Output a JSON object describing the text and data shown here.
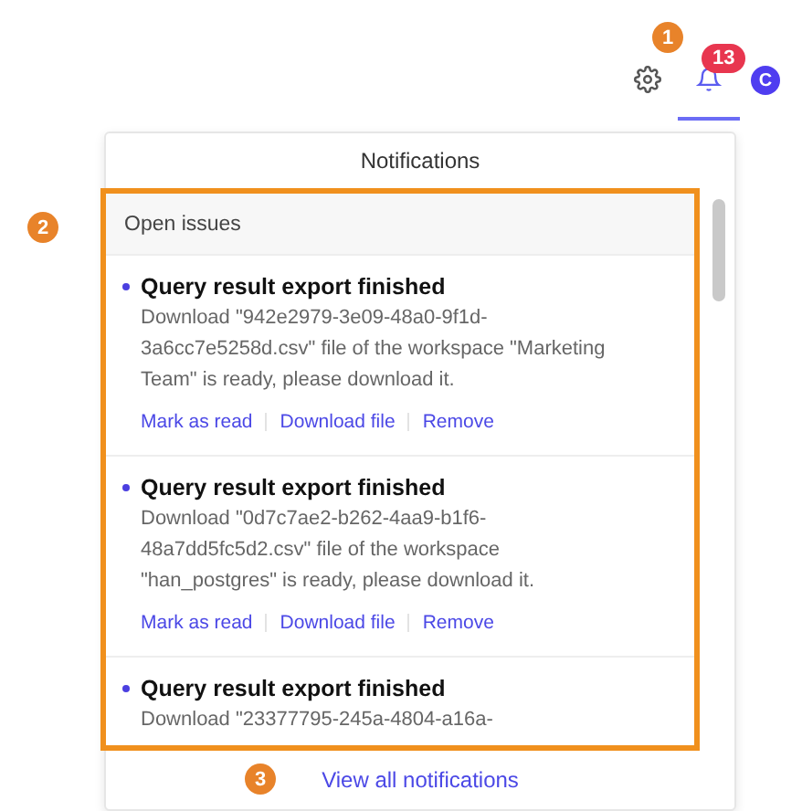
{
  "topbar": {
    "notification_count": "13",
    "avatar": "C",
    "bell_selected": true
  },
  "panel": {
    "title": "Notifications",
    "section": "Open issues",
    "items": [
      {
        "title": "Query result export finished",
        "unread": true,
        "description": "Download \"942e2979-3e09-48a0-9f1d-3a6cc7e5258d.csv\" file of the workspace \"Marketing Team\" is ready, please download it.",
        "actions": [
          "Mark as read",
          "Download file",
          "Remove"
        ]
      },
      {
        "title": "Query result export finished",
        "unread": true,
        "description": "Download \"0d7c7ae2-b262-4aa9-b1f6-48a7dd5fc5d2.csv\" file of the workspace \"han_postgres\" is ready, please download it.",
        "actions": [
          "Mark as read",
          "Download file",
          "Remove"
        ]
      },
      {
        "title": "Query result export finished",
        "unread": true,
        "description": "Download \"23377795-245a-4804-a16a-"
      }
    ],
    "footer_link": "View all notifications"
  },
  "annotations": [
    {
      "label": "1"
    },
    {
      "label": "2"
    },
    {
      "label": "3"
    }
  ]
}
